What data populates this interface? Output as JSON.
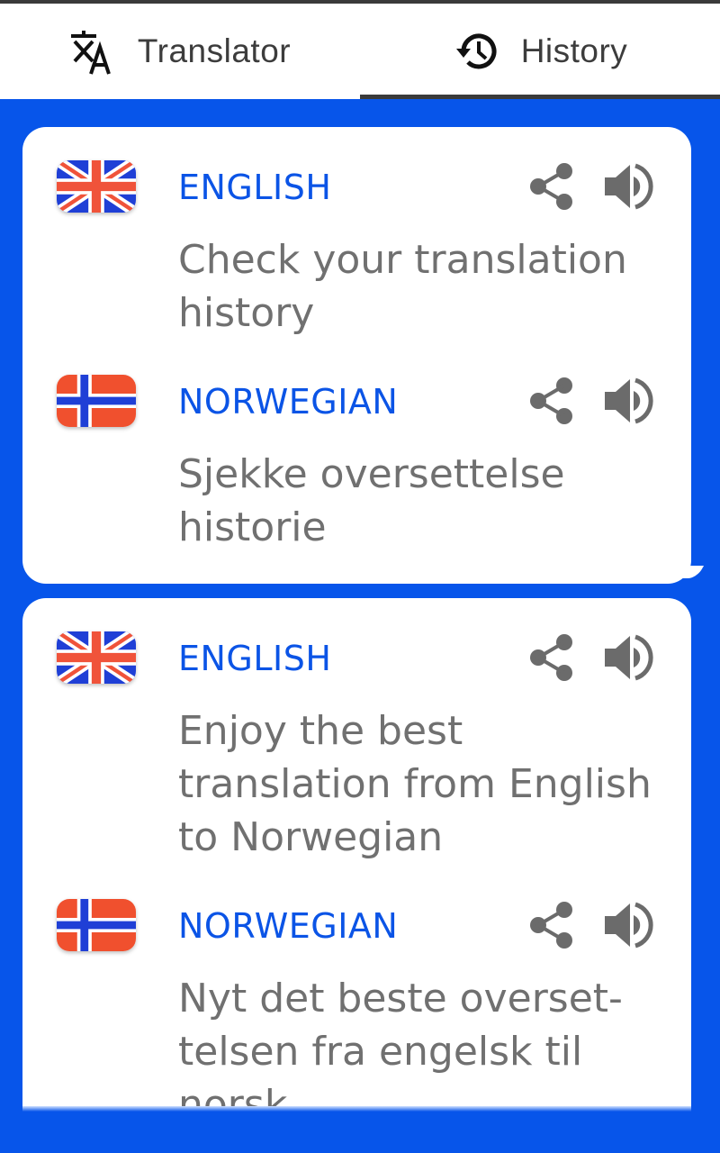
{
  "tabs": [
    {
      "label": "Translator",
      "icon": "translate-icon",
      "active": false
    },
    {
      "label": "History",
      "icon": "history-icon",
      "active": true
    }
  ],
  "colors": {
    "background": "#0755ea",
    "language_label": "#0b54e6",
    "text": "#707070",
    "icon": "#6b6b6b"
  },
  "history": [
    {
      "source": {
        "flag": "uk-flag",
        "language": "ENGLISH",
        "text": "Check your translation history"
      },
      "target": {
        "flag": "norway-flag",
        "language": "NORWEGIAN",
        "text": "Sjekke oversettelse historie"
      }
    },
    {
      "source": {
        "flag": "uk-flag",
        "language": "ENGLISH",
        "text": "Enjoy the best translation from English to Norwegian"
      },
      "target": {
        "flag": "norway-flag",
        "language": "NORWEGIAN",
        "text": "Nyt det beste overset-telsen fra engelsk til norsk"
      }
    }
  ]
}
